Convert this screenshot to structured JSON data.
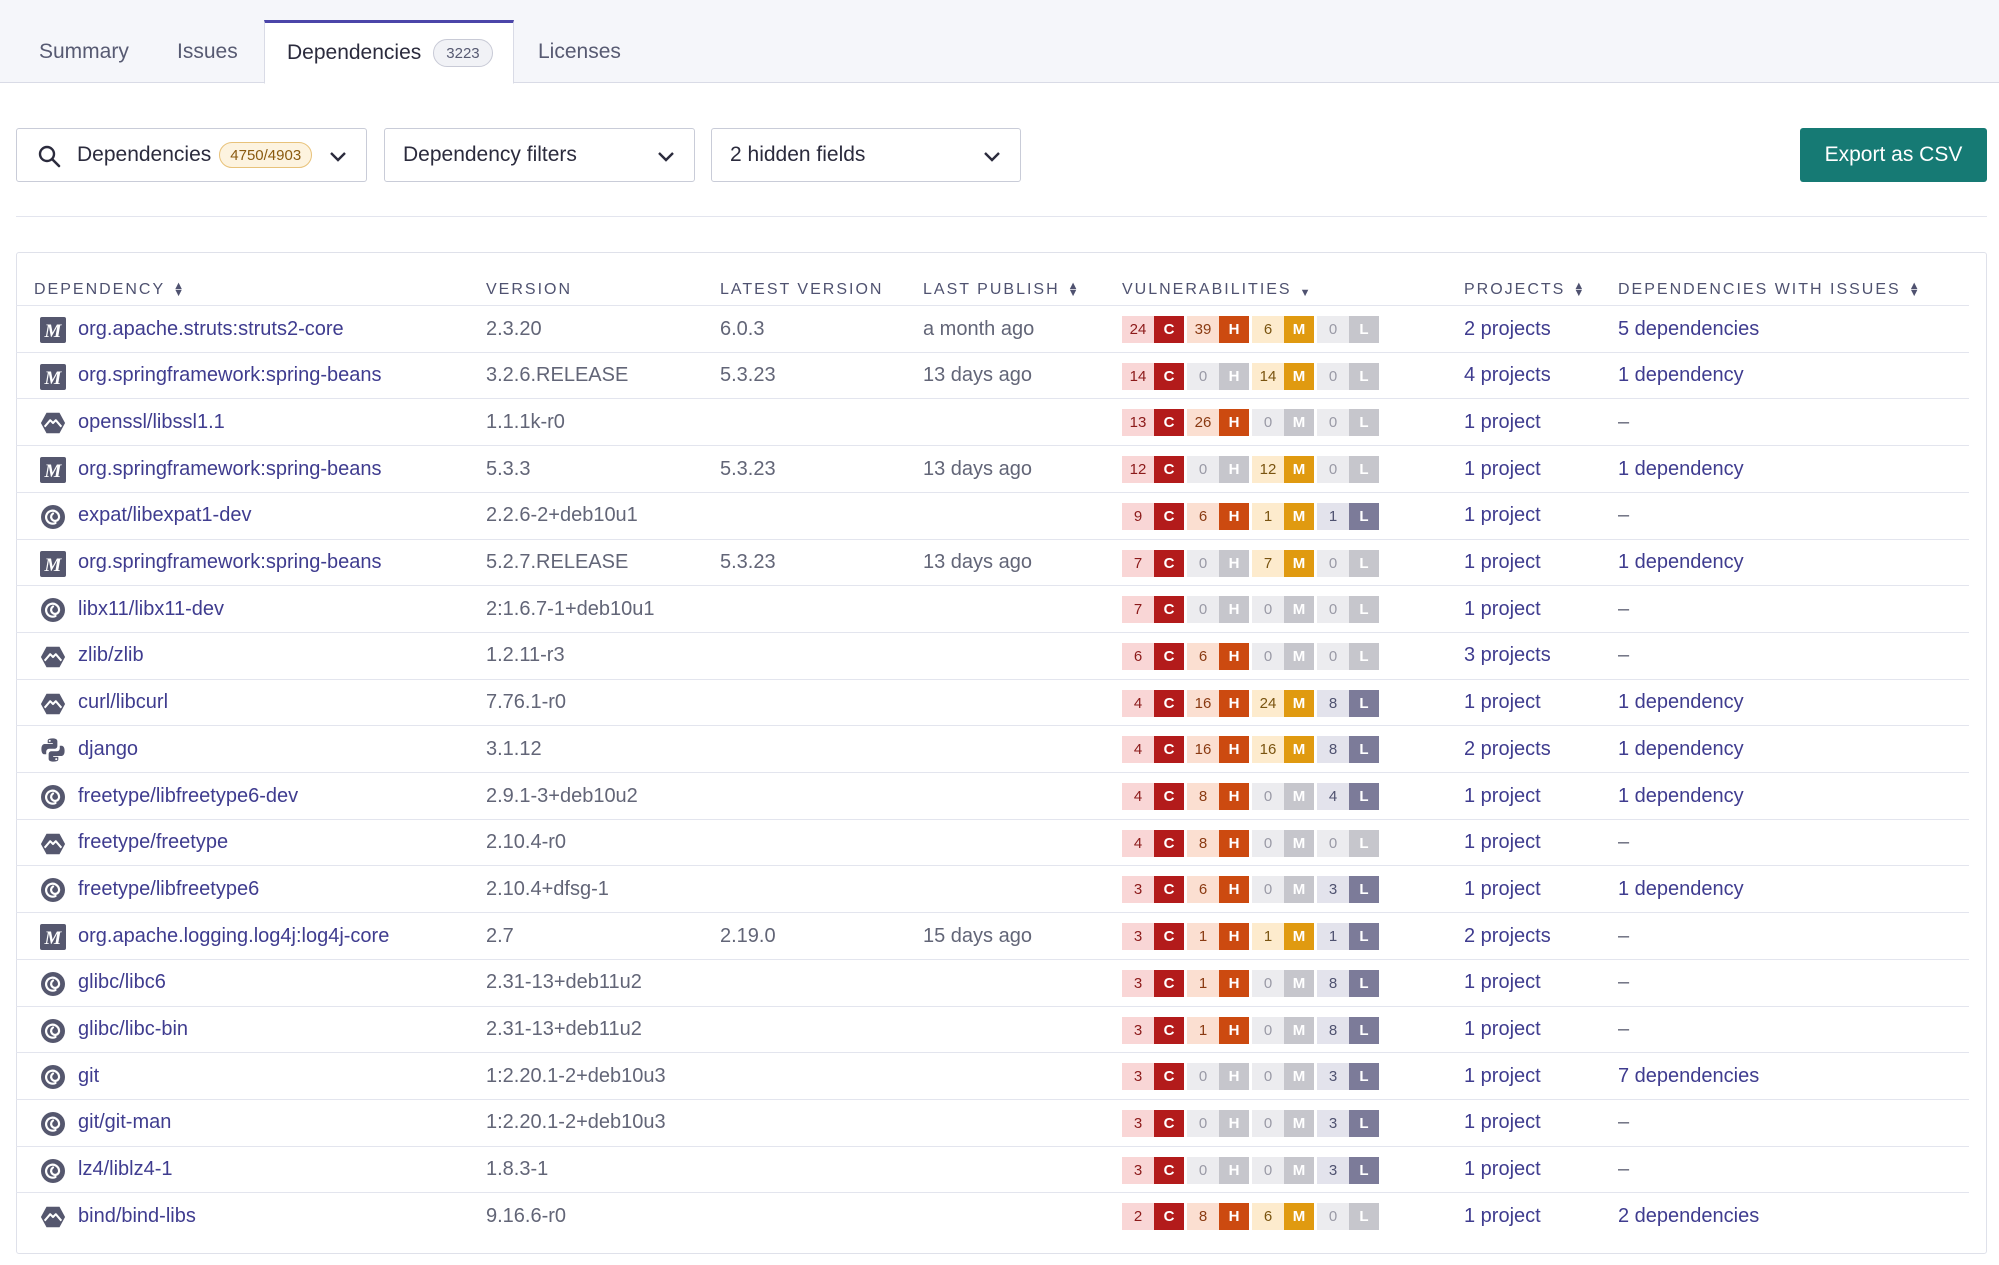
{
  "tabs": [
    {
      "label": "Summary"
    },
    {
      "label": "Issues"
    },
    {
      "label": "Dependencies",
      "count": "3223"
    },
    {
      "label": "Licenses"
    }
  ],
  "toolbar": {
    "search_label": "Dependencies",
    "search_count": "4750/4903",
    "filters_label": "Dependency filters",
    "fields_label": "2 hidden fields",
    "export_label": "Export as CSV"
  },
  "columns": {
    "dependency": "DEPENDENCY",
    "version": "VERSION",
    "latest": "LATEST VERSION",
    "publish": "LAST PUBLISH",
    "vulns": "VULNERABILITIES",
    "projects": "PROJECTS",
    "deps": "DEPENDENCIES WITH ISSUES"
  },
  "severity_letters": {
    "c": "C",
    "h": "H",
    "m": "M",
    "l": "L"
  },
  "colors": {
    "accent": "#4b45a9",
    "link": "#3f3c8f",
    "export": "#167a74",
    "critical": "#b31b1b",
    "high": "#cc4a10",
    "medium": "#e09a10",
    "low": "#7c7b99",
    "zero": "#c6c6cc"
  },
  "rows": [
    {
      "icon": "maven-icon",
      "name": "org.apache.struts:struts2-core",
      "version": "2.3.20",
      "latest": "6.0.3",
      "publish": "a month ago",
      "c": "24",
      "h": "39",
      "m": "6",
      "l": "0",
      "projects": "2 projects",
      "deps": "5 dependencies"
    },
    {
      "icon": "maven-icon",
      "name": "org.springframework:spring-beans",
      "version": "3.2.6.RELEASE",
      "latest": "5.3.23",
      "publish": "13 days ago",
      "c": "14",
      "h": "0",
      "m": "14",
      "l": "0",
      "projects": "4 projects",
      "deps": "1 dependency"
    },
    {
      "icon": "alpine-icon",
      "name": "openssl/libssl1.1",
      "version": "1.1.1k-r0",
      "latest": "",
      "publish": "",
      "c": "13",
      "h": "26",
      "m": "0",
      "l": "0",
      "projects": "1 project",
      "deps": "–"
    },
    {
      "icon": "maven-icon",
      "name": "org.springframework:spring-beans",
      "version": "5.3.3",
      "latest": "5.3.23",
      "publish": "13 days ago",
      "c": "12",
      "h": "0",
      "m": "12",
      "l": "0",
      "projects": "1 project",
      "deps": "1 dependency"
    },
    {
      "icon": "debian-icon",
      "name": "expat/libexpat1-dev",
      "version": "2.2.6-2+deb10u1",
      "latest": "",
      "publish": "",
      "c": "9",
      "h": "6",
      "m": "1",
      "l": "1",
      "projects": "1 project",
      "deps": "–"
    },
    {
      "icon": "maven-icon",
      "name": "org.springframework:spring-beans",
      "version": "5.2.7.RELEASE",
      "latest": "5.3.23",
      "publish": "13 days ago",
      "c": "7",
      "h": "0",
      "m": "7",
      "l": "0",
      "projects": "1 project",
      "deps": "1 dependency"
    },
    {
      "icon": "debian-icon",
      "name": "libx11/libx11-dev",
      "version": "2:1.6.7-1+deb10u1",
      "latest": "",
      "publish": "",
      "c": "7",
      "h": "0",
      "m": "0",
      "l": "0",
      "projects": "1 project",
      "deps": "–"
    },
    {
      "icon": "alpine-icon",
      "name": "zlib/zlib",
      "version": "1.2.11-r3",
      "latest": "",
      "publish": "",
      "c": "6",
      "h": "6",
      "m": "0",
      "l": "0",
      "projects": "3 projects",
      "deps": "–"
    },
    {
      "icon": "alpine-icon",
      "name": "curl/libcurl",
      "version": "7.76.1-r0",
      "latest": "",
      "publish": "",
      "c": "4",
      "h": "16",
      "m": "24",
      "l": "8",
      "projects": "1 project",
      "deps": "1 dependency"
    },
    {
      "icon": "python-icon",
      "name": "django",
      "version": "3.1.12",
      "latest": "",
      "publish": "",
      "c": "4",
      "h": "16",
      "m": "16",
      "l": "8",
      "projects": "2 projects",
      "deps": "1 dependency"
    },
    {
      "icon": "debian-icon",
      "name": "freetype/libfreetype6-dev",
      "version": "2.9.1-3+deb10u2",
      "latest": "",
      "publish": "",
      "c": "4",
      "h": "8",
      "m": "0",
      "l": "4",
      "projects": "1 project",
      "deps": "1 dependency"
    },
    {
      "icon": "alpine-icon",
      "name": "freetype/freetype",
      "version": "2.10.4-r0",
      "latest": "",
      "publish": "",
      "c": "4",
      "h": "8",
      "m": "0",
      "l": "0",
      "projects": "1 project",
      "deps": "–"
    },
    {
      "icon": "debian-icon",
      "name": "freetype/libfreetype6",
      "version": "2.10.4+dfsg-1",
      "latest": "",
      "publish": "",
      "c": "3",
      "h": "6",
      "m": "0",
      "l": "3",
      "projects": "1 project",
      "deps": "1 dependency"
    },
    {
      "icon": "maven-icon",
      "name": "org.apache.logging.log4j:log4j-core",
      "version": "2.7",
      "latest": "2.19.0",
      "publish": "15 days ago",
      "c": "3",
      "h": "1",
      "m": "1",
      "l": "1",
      "projects": "2 projects",
      "deps": "–"
    },
    {
      "icon": "debian-icon",
      "name": "glibc/libc6",
      "version": "2.31-13+deb11u2",
      "latest": "",
      "publish": "",
      "c": "3",
      "h": "1",
      "m": "0",
      "l": "8",
      "projects": "1 project",
      "deps": "–"
    },
    {
      "icon": "debian-icon",
      "name": "glibc/libc-bin",
      "version": "2.31-13+deb11u2",
      "latest": "",
      "publish": "",
      "c": "3",
      "h": "1",
      "m": "0",
      "l": "8",
      "projects": "1 project",
      "deps": "–"
    },
    {
      "icon": "debian-icon",
      "name": "git",
      "version": "1:2.20.1-2+deb10u3",
      "latest": "",
      "publish": "",
      "c": "3",
      "h": "0",
      "m": "0",
      "l": "3",
      "projects": "1 project",
      "deps": "7 dependencies"
    },
    {
      "icon": "debian-icon",
      "name": "git/git-man",
      "version": "1:2.20.1-2+deb10u3",
      "latest": "",
      "publish": "",
      "c": "3",
      "h": "0",
      "m": "0",
      "l": "3",
      "projects": "1 project",
      "deps": "–"
    },
    {
      "icon": "debian-icon",
      "name": "lz4/liblz4-1",
      "version": "1.8.3-1",
      "latest": "",
      "publish": "",
      "c": "3",
      "h": "0",
      "m": "0",
      "l": "3",
      "projects": "1 project",
      "deps": "–"
    },
    {
      "icon": "alpine-icon",
      "name": "bind/bind-libs",
      "version": "9.16.6-r0",
      "latest": "",
      "publish": "",
      "c": "2",
      "h": "8",
      "m": "6",
      "l": "0",
      "projects": "1 project",
      "deps": "2 dependencies"
    }
  ]
}
